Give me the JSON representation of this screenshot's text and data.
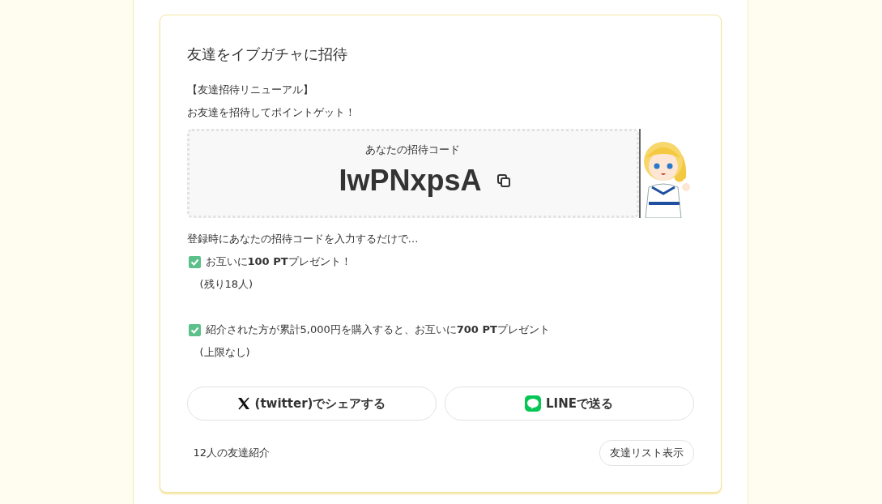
{
  "invite_card": {
    "title": "友達をイブガチャに招待",
    "intro": [
      "【友達招待リニューアル】",
      "お友達を招待してポイントゲット！"
    ],
    "code_box": {
      "label": "あなたの招待コード",
      "code": "IwPNxpsA"
    },
    "lead": "登録時にあなたの招待コードを入力するだけで…",
    "benefits": [
      {
        "checked": true,
        "text": "お互いに**100 PT**プレゼント！",
        "note": "(残り18人)"
      },
      {
        "checked": true,
        "text": "紹介された方が累計5,000円を購入すると、お互いに**700 PT**プレゼント",
        "note": "(上限なし)"
      }
    ],
    "share_buttons": [
      {
        "kind": "x",
        "label": "(twitter)でシェアする"
      },
      {
        "kind": "line",
        "label": "LINEで送る"
      }
    ],
    "referral_count": "12人の友達紹介",
    "list_button": "友達リスト表示"
  }
}
